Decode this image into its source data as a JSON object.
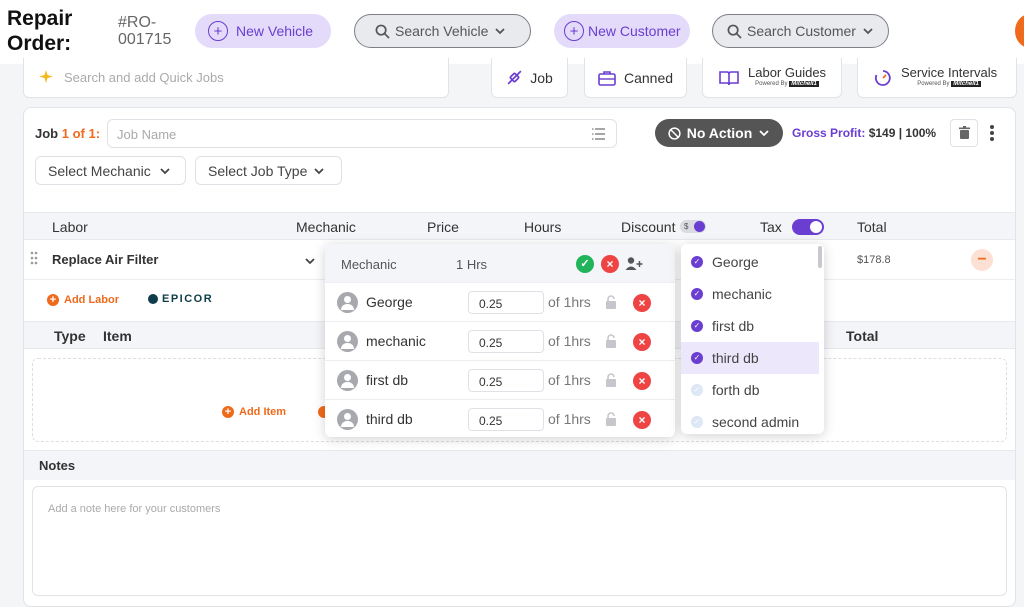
{
  "header": {
    "title": "Repair Order:",
    "ro_number": "#RO-001715",
    "new_vehicle": "New Vehicle",
    "search_vehicle": "Search Vehicle",
    "new_customer": "New Customer",
    "search_customer": "Search Customer"
  },
  "toolbar": {
    "quick_jobs_placeholder": "Search and add Quick Jobs",
    "job": "Job",
    "canned": "Canned",
    "labor_guides": "Labor Guides",
    "service_intervals": "Service Intervals",
    "powered_by": "Powered By",
    "mitchell": "Mitchell1"
  },
  "job": {
    "label": "Job",
    "counter": "1 of 1:",
    "name_placeholder": "Job Name",
    "select_mechanic": "Select Mechanic",
    "select_job_type": "Select Job Type",
    "no_action": "No Action",
    "gross_profit_label": "Gross Profit:",
    "gross_profit_value": "$149 | 100%"
  },
  "labor_table": {
    "headers": {
      "labor": "Labor",
      "mechanic": "Mechanic",
      "price": "Price",
      "hours": "Hours",
      "discount": "Discount",
      "discount_badge": "$",
      "tax": "Tax",
      "total": "Total"
    },
    "tax_enabled": true,
    "rows": [
      {
        "labor": "Replace Air Filter",
        "total": "$178.8"
      }
    ],
    "add_labor": "Add Labor",
    "epicor": "EPICOR"
  },
  "items_table": {
    "headers": {
      "type": "Type",
      "item": "Item",
      "total": "Total"
    },
    "add_item": "Add Item"
  },
  "notes": {
    "label": "Notes",
    "placeholder": "Add a note here for your customers"
  },
  "mechanic_popup": {
    "header_mechanic": "Mechanic",
    "header_hours": "1 Hrs",
    "rows": [
      {
        "name": "George",
        "hours": "0.25",
        "of": "of 1hrs"
      },
      {
        "name": "mechanic",
        "hours": "0.25",
        "of": "of 1hrs"
      },
      {
        "name": "first db",
        "hours": "0.25",
        "of": "of 1hrs"
      },
      {
        "name": "third db",
        "hours": "0.25",
        "of": "of 1hrs"
      }
    ]
  },
  "mechanic_dropdown": {
    "items": [
      {
        "name": "George",
        "checked": true,
        "active": false
      },
      {
        "name": "mechanic",
        "checked": true,
        "active": false
      },
      {
        "name": "first db",
        "checked": true,
        "active": false
      },
      {
        "name": "third db",
        "checked": true,
        "active": true
      },
      {
        "name": "forth db",
        "checked": false,
        "active": false
      },
      {
        "name": "second admin",
        "checked": false,
        "active": false
      }
    ]
  },
  "colors": {
    "accent": "#6a3ed0",
    "orange": "#f06a1c",
    "danger": "#ef4444",
    "success": "#22b45a"
  }
}
